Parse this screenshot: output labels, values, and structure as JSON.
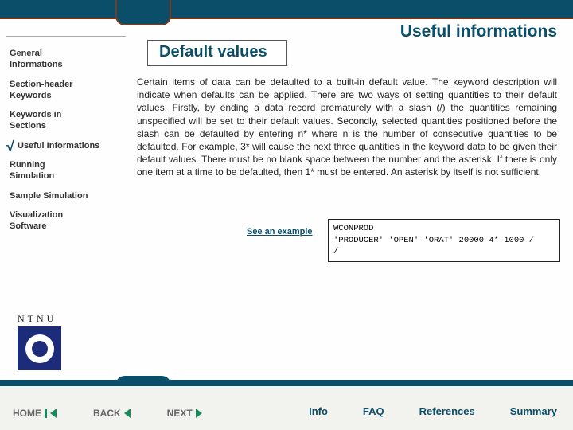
{
  "title": "Useful informations",
  "heading": "Default values",
  "nav": {
    "item0": "General\nInformations",
    "item1": "Section-header\nKeywords",
    "item2": "Keywords in\nSections",
    "item3": "Useful Informations",
    "item4": "Running\nSimulation",
    "item5": "Sample Simulation",
    "item6": "Visualization\nSoftware"
  },
  "ntnu": "NTNU",
  "body": "Certain items of data can be defaulted to a built-in default value. The keyword description will indicate when defaults can be applied. There are two ways of setting quantities to their default values. Firstly, by ending a data record prematurely with a slash (/) the quantities remaining unspecified will be set to their default values. Secondly, selected quantities positioned before the slash can be defaulted by entering n* where n is the number of consecutive quantities to be defaulted. For example, 3* will cause the next three quantities in the keyword data to be given their default values. There must be no blank space between the number and the asterisk. If there is only one item at a time to be defaulted, then 1* must be entered. An asterisk by itself is not sufficient.",
  "see_example": "See an example",
  "code": {
    "l1": "WCONPROD",
    "l2": " 'PRODUCER' 'OPEN' 'ORAT' 20000  4*  1000 /",
    "l3": "/"
  },
  "footer": {
    "home": "HOME",
    "back": "BACK",
    "next": "NEXT",
    "info": "Info",
    "faq": "FAQ",
    "refs": "References",
    "summary": "Summary"
  }
}
